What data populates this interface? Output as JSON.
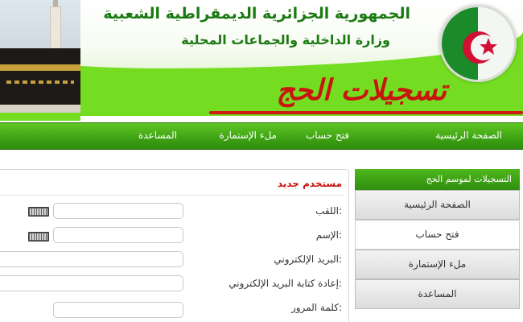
{
  "header": {
    "line1": "الجمهورية الجزائرية الديمقراطية الشعبية",
    "line2": "وزارة الداخلية والجماعات المحلية",
    "title": "تسجيلات الحج"
  },
  "nav": {
    "home": "الصفحة الرئيسية",
    "open_account": "فتح حساب",
    "fill_form": "ملء الإستمارة",
    "help": "المساعدة"
  },
  "sidebar": {
    "header": "التسجيلات لموسم الحج",
    "items": [
      {
        "label": "الصفحة الرئيسية"
      },
      {
        "label": "فتح حساب"
      },
      {
        "label": "ملء الإستمارة"
      },
      {
        "label": "المساعدة"
      }
    ]
  },
  "form": {
    "title": "مستخدم جديد",
    "labels": {
      "title": "اللقب:",
      "name": "الإسم:",
      "email": "البريد الإلكتروني:",
      "email_confirm": "إعادة كتابة البريد الإلكتروني:",
      "password": "كلمة المرور:"
    },
    "values": {
      "title": "",
      "name": "",
      "email": "",
      "email_confirm": "",
      "password": ""
    }
  },
  "colors": {
    "green_dark": "#2f8d0e",
    "green_light": "#74dd22",
    "red_accent": "#c8150e",
    "header_text": "#1a7a12"
  }
}
